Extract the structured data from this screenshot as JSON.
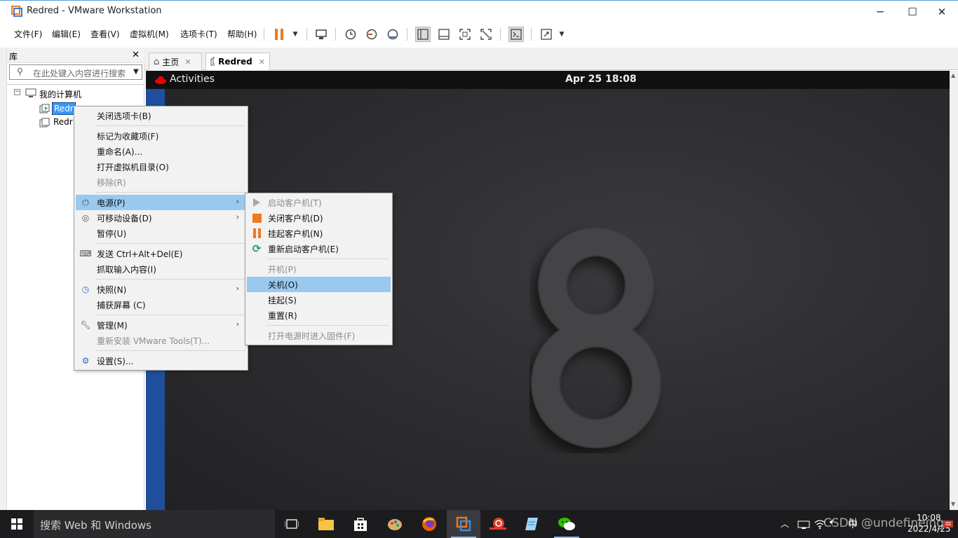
{
  "window": {
    "title": "Redred - VMware Workstation",
    "minimize": "─",
    "maximize": "☐",
    "close": "✕"
  },
  "menubar": {
    "items": [
      "文件(F)",
      "编辑(E)",
      "查看(V)",
      "虚拟机(M)",
      "选项卡(T)",
      "帮助(H)"
    ]
  },
  "library": {
    "title": "库",
    "close": "✕",
    "search_placeholder": "在此处键入内容进行搜索",
    "root": "我的计算机",
    "vms": [
      "Redr",
      "Redr"
    ]
  },
  "tabs": [
    {
      "label": "主页"
    },
    {
      "label": "Redred"
    }
  ],
  "guest": {
    "activities": "Activities",
    "clock": "Apr 25  18:08",
    "logo_digit": "8"
  },
  "context_menu": {
    "items": [
      {
        "label": "关闭选项卡(B)",
        "disabled": false
      },
      {
        "label": "标记为收藏项(F)",
        "disabled": false
      },
      {
        "label": "重命名(A)...",
        "disabled": false
      },
      {
        "label": "打开虚拟机目录(O)",
        "disabled": false
      },
      {
        "label": "移除(R)",
        "disabled": true
      },
      {
        "label": "电源(P)",
        "icon": "power-icon",
        "submenu": true,
        "highlighted": true
      },
      {
        "label": "可移动设备(D)",
        "icon": "removable-device-icon",
        "submenu": true
      },
      {
        "label": "暂停(U)"
      },
      {
        "label": "发送 Ctrl+Alt+Del(E)",
        "icon": "send-keys-icon"
      },
      {
        "label": "抓取输入内容(I)"
      },
      {
        "label": "快照(N)",
        "icon": "snapshot-icon",
        "submenu": true
      },
      {
        "label": "捕获屏幕 (C)"
      },
      {
        "label": "管理(M)",
        "icon": "wrench-icon",
        "submenu": true
      },
      {
        "label": "重新安装 VMware Tools(T)...",
        "disabled": true
      },
      {
        "label": "设置(S)...",
        "icon": "settings-icon"
      }
    ]
  },
  "power_submenu": {
    "items": [
      {
        "label": "启动客户机(T)",
        "disabled": true,
        "icon": "play-icon"
      },
      {
        "label": "关闭客户机(D)",
        "icon": "stop-icon"
      },
      {
        "label": "挂起客户机(N)",
        "icon": "suspend-icon"
      },
      {
        "label": "重新启动客户机(E)",
        "icon": "restart-icon"
      },
      {
        "label": "开机(P)",
        "disabled": true
      },
      {
        "label": "关机(O)",
        "highlighted": true
      },
      {
        "label": "挂起(S)"
      },
      {
        "label": "重置(R)"
      },
      {
        "label": "打开电源时进入固件(F)",
        "disabled": true
      }
    ]
  },
  "taskbar": {
    "search": "搜索 Web 和 Windows",
    "time": "10:08",
    "date": "2022/4/25",
    "ime": "中",
    "watermark": "CSDN @undefineing"
  },
  "colors": {
    "accent": "#99c9ef",
    "vm_bg": "#2a2a2c",
    "taskbar": "#1c1c1e",
    "pause_orange": "#f0781e"
  }
}
